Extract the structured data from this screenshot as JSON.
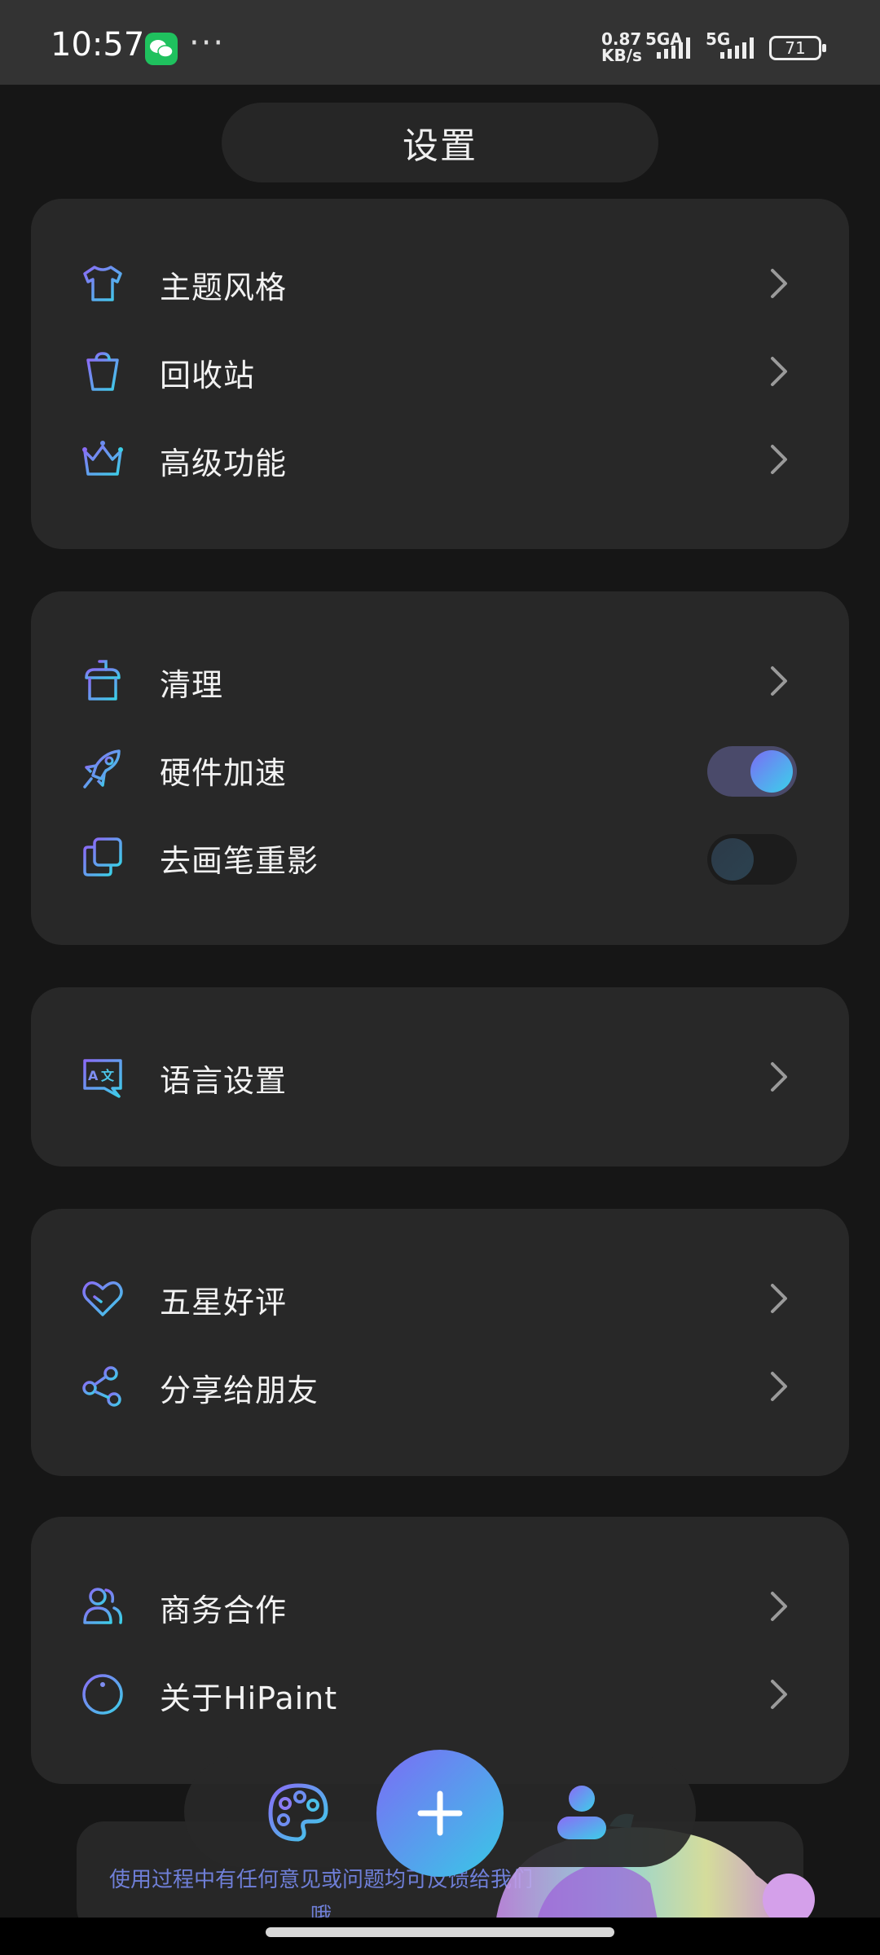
{
  "status_bar": {
    "time": "10:57",
    "dots": "···",
    "net_speed_value": "0.87",
    "net_speed_unit": "KB/s",
    "sim1": "5GA",
    "sim2": "5G",
    "battery": "71"
  },
  "title": "设置",
  "groups": [
    {
      "items": [
        {
          "label": "主题风格",
          "icon": "shirt-icon",
          "control": "chevron"
        },
        {
          "label": "回收站",
          "icon": "trash-icon",
          "control": "chevron"
        },
        {
          "label": "高级功能",
          "icon": "crown-icon",
          "control": "chevron"
        }
      ]
    },
    {
      "items": [
        {
          "label": "清理",
          "icon": "broom-icon",
          "control": "chevron"
        },
        {
          "label": "硬件加速",
          "icon": "rocket-icon",
          "control": "toggle",
          "value": true
        },
        {
          "label": "去画笔重影",
          "icon": "copy-icon",
          "control": "toggle",
          "value": false
        }
      ]
    },
    {
      "items": [
        {
          "label": "语言设置",
          "icon": "translate-icon",
          "control": "chevron"
        }
      ]
    },
    {
      "items": [
        {
          "label": "五星好评",
          "icon": "heart-icon",
          "control": "chevron"
        },
        {
          "label": "分享给朋友",
          "icon": "share-icon",
          "control": "chevron"
        }
      ]
    },
    {
      "items": [
        {
          "label": "商务合作",
          "icon": "users-icon",
          "control": "chevron"
        },
        {
          "label": "关于HiPaint",
          "icon": "info-icon",
          "control": "chevron"
        }
      ]
    }
  ],
  "promo": {
    "text": "使用过程中有任何意见或问题均可反馈给我们哦"
  },
  "bottom_nav": {
    "left": "palette-icon",
    "center": "add-icon",
    "right": "user-icon"
  },
  "colors": {
    "accent_start": "#7b6cf5",
    "accent_end": "#38c9e6",
    "card": "#282828",
    "background": "#161616"
  }
}
